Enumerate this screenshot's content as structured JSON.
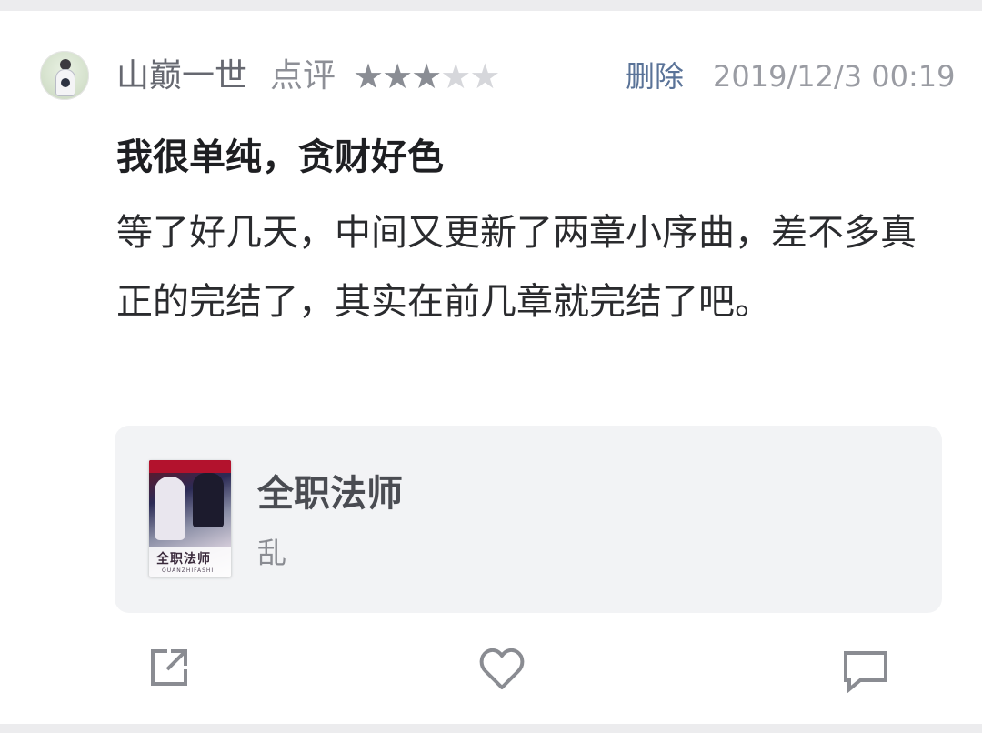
{
  "review": {
    "author": "山巅一世",
    "action_label": "点评",
    "rating": {
      "filled": 3,
      "total": 5,
      "star_char": "★"
    },
    "delete_label": "删除",
    "timestamp": "2019/12/3 00:19",
    "title": "我很单纯，贪财好色",
    "body": "等了好几天，中间又更新了两章小序曲，差不多真正的完结了，其实在前几章就完结了吧。"
  },
  "book": {
    "title": "全职法师",
    "note": "乱",
    "cover_title": "全职法师",
    "cover_subtitle": "QUANZHIFASHI"
  },
  "footer": {
    "icons": [
      "share-icon",
      "like-icon",
      "comment-icon"
    ]
  },
  "colors": {
    "icon_stroke": "#8a8c92",
    "delete_link": "#5a7398",
    "book_card_bg": "#f2f3f5"
  }
}
